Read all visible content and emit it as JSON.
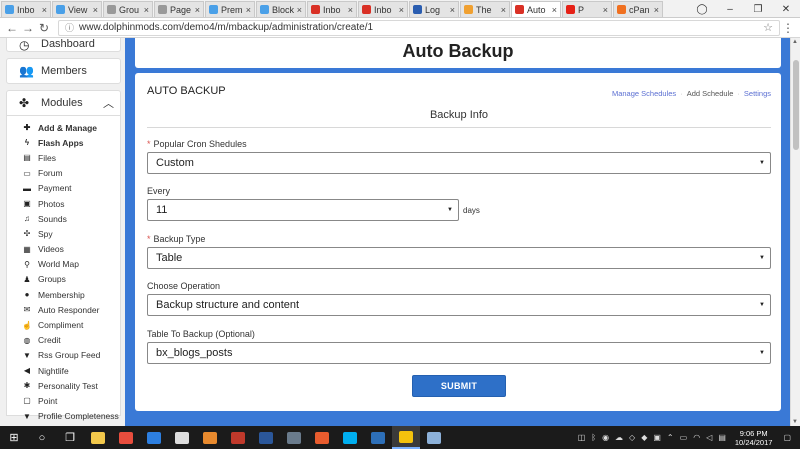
{
  "browser": {
    "tabs": [
      {
        "label": "Inbo",
        "color": "#4aa0e8",
        "active": false
      },
      {
        "label": "View",
        "color": "#4aa0e8",
        "active": false
      },
      {
        "label": "Grou",
        "color": "#999999",
        "active": false
      },
      {
        "label": "Page",
        "color": "#999999",
        "active": false
      },
      {
        "label": "Prem",
        "color": "#4aa0e8",
        "active": false
      },
      {
        "label": "Block",
        "color": "#4aa0e8",
        "active": false
      },
      {
        "label": "Inbo",
        "color": "#d93025",
        "active": false
      },
      {
        "label": "Inbo",
        "color": "#d93025",
        "active": false
      },
      {
        "label": "Log",
        "color": "#2a5db0",
        "active": false
      },
      {
        "label": "The",
        "color": "#f0a030",
        "active": false
      },
      {
        "label": "Auto",
        "color": "#d93025",
        "active": true
      },
      {
        "label": "P",
        "color": "#e62117",
        "active": false
      },
      {
        "label": "cPan",
        "color": "#f07020",
        "active": false
      }
    ],
    "close_glyph": "×",
    "url": "www.dolphinmods.com/demo4/m/mbackup/administration/create/1",
    "window_controls": [
      "–",
      "❐",
      "✕"
    ]
  },
  "sidebar": {
    "dashboard_label": "Dashboard",
    "members_label": "Members",
    "modules_label": "Modules",
    "modules_items": [
      {
        "label": "Add & Manage",
        "icon": "plus-icon",
        "glyph": "✚",
        "bold": true
      },
      {
        "label": "Flash Apps",
        "icon": "bolt-icon",
        "glyph": "ϟ",
        "bold": true
      },
      {
        "label": "Files",
        "icon": "file-icon",
        "glyph": "▤",
        "bold": false
      },
      {
        "label": "Forum",
        "icon": "comments-icon",
        "glyph": "▭",
        "bold": false
      },
      {
        "label": "Payment",
        "icon": "credit-card-icon",
        "glyph": "▬",
        "bold": false
      },
      {
        "label": "Photos",
        "icon": "picture-icon",
        "glyph": "▣",
        "bold": false
      },
      {
        "label": "Sounds",
        "icon": "music-icon",
        "glyph": "♫",
        "bold": false
      },
      {
        "label": "Spy",
        "icon": "crosshair-icon",
        "glyph": "✣",
        "bold": false
      },
      {
        "label": "Videos",
        "icon": "film-icon",
        "glyph": "▦",
        "bold": false
      },
      {
        "label": "World Map",
        "icon": "map-marker-icon",
        "glyph": "⚲",
        "bold": false
      },
      {
        "label": "Groups",
        "icon": "group-icon",
        "glyph": "♟",
        "bold": false
      },
      {
        "label": "Membership",
        "icon": "circle-icon",
        "glyph": "●",
        "bold": false
      },
      {
        "label": "Auto Responder",
        "icon": "reply-icon",
        "glyph": "✉",
        "bold": false
      },
      {
        "label": "Compliment",
        "icon": "thumbs-up-icon",
        "glyph": "☝",
        "bold": false
      },
      {
        "label": "Credit",
        "icon": "money-icon",
        "glyph": "◍",
        "bold": false
      },
      {
        "label": "Rss Group Feed",
        "icon": "filter-icon",
        "glyph": "▼",
        "bold": false
      },
      {
        "label": "Nightlife",
        "icon": "bullhorn-icon",
        "glyph": "◀",
        "bold": false
      },
      {
        "label": "Personality Test",
        "icon": "asterisk-icon",
        "glyph": "✱",
        "bold": false
      },
      {
        "label": "Point",
        "icon": "square-icon",
        "glyph": "▢",
        "bold": false
      },
      {
        "label": "Profile Completeness",
        "icon": "filter-icon",
        "glyph": "▼",
        "bold": false
      }
    ]
  },
  "main": {
    "page_title": "Auto Backup",
    "panel_title": "AUTO BACKUP",
    "links": {
      "manage": "Manage Schedules",
      "add": "Add Schedule",
      "settings": "Settings",
      "sep": "·"
    },
    "section_title": "Backup Info",
    "fields": {
      "cron_label": "Popular Cron Shedules",
      "cron_value": "Custom",
      "every_label": "Every",
      "every_value": "11",
      "every_unit": "days",
      "type_label": "Backup Type",
      "type_value": "Table",
      "operation_label": "Choose Operation",
      "operation_value": "Backup structure and content",
      "table_label": "Table To Backup (Optional)",
      "table_value": "bx_blogs_posts",
      "required_mark": "*"
    },
    "submit_label": "SUBMIT"
  },
  "taskbar": {
    "apps": [
      {
        "name": "file-explorer-app",
        "color": "#f2c84b"
      },
      {
        "name": "store-app",
        "color": "#e84d3d"
      },
      {
        "name": "edge-app",
        "color": "#2d7fe0"
      },
      {
        "name": "mail-app",
        "color": "#dddddd"
      },
      {
        "name": "paint-app",
        "color": "#e88a2e"
      },
      {
        "name": "filezilla-app",
        "color": "#c0392b"
      },
      {
        "name": "word-app",
        "color": "#2b579a"
      },
      {
        "name": "photos-app",
        "color": "#6a7b8c"
      },
      {
        "name": "outlook-app",
        "color": "#e85c2e"
      },
      {
        "name": "skype-app",
        "color": "#00aff0"
      },
      {
        "name": "notes-app",
        "color": "#2d6fb8"
      },
      {
        "name": "chrome-app",
        "color": "#f4c20d"
      },
      {
        "name": "tool-app",
        "color": "#8db1d9"
      }
    ],
    "time": "9:06 PM",
    "date": "10/24/2017"
  }
}
